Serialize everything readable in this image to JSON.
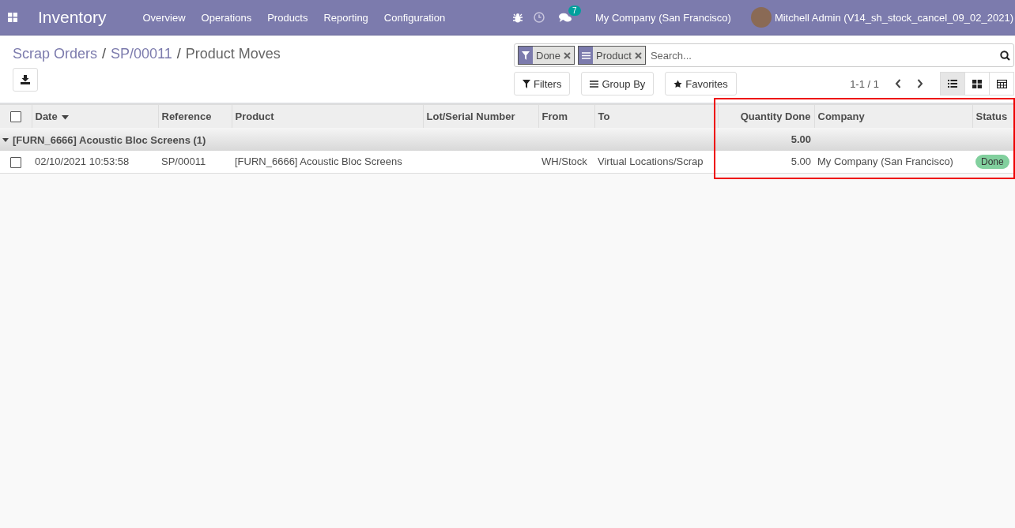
{
  "navbar": {
    "app_name": "Inventory",
    "menu": [
      "Overview",
      "Operations",
      "Products",
      "Reporting",
      "Configuration"
    ],
    "messages_count": "7",
    "company": "My Company (San Francisco)",
    "user": "Mitchell Admin (V14_sh_stock_cancel_09_02_2021)"
  },
  "breadcrumbs": [
    {
      "label": "Scrap Orders",
      "current": false
    },
    {
      "separator": "/",
      "label": "SP/00011",
      "current": false
    },
    {
      "separator": "/",
      "label": "Product Moves",
      "current": true
    }
  ],
  "search": {
    "facets": [
      {
        "kind": "filter",
        "label": "Done"
      },
      {
        "kind": "group",
        "label": "Product"
      }
    ],
    "placeholder": "Search..."
  },
  "search_buttons": [
    {
      "kind": "filter",
      "label": "Filters"
    },
    {
      "kind": "group",
      "label": "Group By"
    },
    {
      "kind": "star",
      "label": "Favorites"
    }
  ],
  "pager": "1-1 / 1",
  "views": [
    {
      "kind": "list",
      "selected": true
    },
    {
      "kind": "kanban",
      "selected": false
    },
    {
      "kind": "pivot",
      "selected": false
    }
  ],
  "table": {
    "select_all_checked": false,
    "columns": [
      {
        "label": "Date",
        "sorted": true
      },
      {
        "label": "Reference",
        "sorted": false
      },
      {
        "label": "Product",
        "sorted": false
      },
      {
        "label": "Lot/Serial Number",
        "sorted": false
      },
      {
        "label": "From",
        "sorted": false
      },
      {
        "label": "To",
        "sorted": false
      },
      {
        "label": "Quantity Done",
        "sorted": false
      },
      {
        "label": "Company",
        "sorted": false
      },
      {
        "label": "Status",
        "sorted": false
      }
    ],
    "groups": [
      {
        "label": "[FURN_6666] Acoustic Bloc Screens (1)",
        "expanded": true,
        "total": "5.00",
        "rows": [
          {
            "checked": false,
            "cells": [
              "02/10/2021 10:53:58",
              "SP/00011",
              "[FURN_6666] Acoustic Bloc Screens",
              "",
              "WH/Stock",
              "Virtual Locations/Scrap",
              "5.00",
              "My Company (San Francisco)"
            ],
            "status": "Done"
          }
        ]
      }
    ]
  }
}
